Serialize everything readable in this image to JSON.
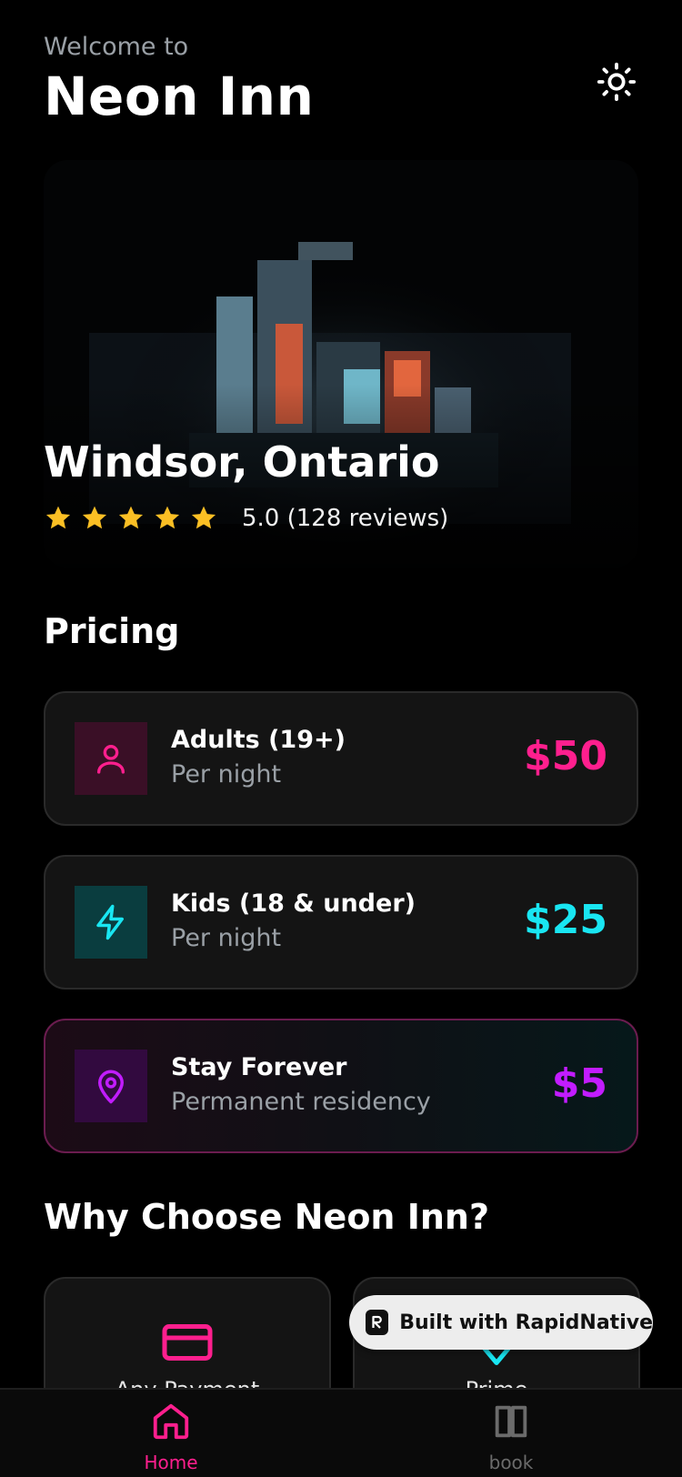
{
  "header": {
    "welcome": "Welcome to",
    "title": "Neon Inn",
    "theme_icon": "sun-icon"
  },
  "hero": {
    "location": "Windsor, Ontario",
    "stars": 5,
    "rating_text": "5.0 (128 reviews)"
  },
  "pricing": {
    "title": "Pricing",
    "items": [
      {
        "name": "Adults (19+)",
        "sub": "Per night",
        "price": "$50",
        "icon": "user-icon",
        "color": "#ff1f8e"
      },
      {
        "name": "Kids (18 & under)",
        "sub": "Per night",
        "price": "$25",
        "icon": "lightning-icon",
        "color": "#19e6f2"
      },
      {
        "name": "Stay Forever",
        "sub": "Permanent residency",
        "price": "$5",
        "icon": "location-pin-icon",
        "color": "#c21cff"
      }
    ]
  },
  "features": {
    "title": "Why Choose Neon Inn?",
    "items": [
      {
        "label": "Any Payment",
        "icon": "credit-card-icon"
      },
      {
        "label": "Prime",
        "icon": "diamond-icon"
      }
    ]
  },
  "badge": {
    "text": "Built with RapidNative"
  },
  "tabs": [
    {
      "label": "Home",
      "icon": "home-icon",
      "active": true
    },
    {
      "label": "book",
      "icon": "book-icon",
      "active": false
    }
  ],
  "colors": {
    "accent_pink": "#ff1f8e",
    "accent_cyan": "#19e6f2",
    "accent_purple": "#c21cff",
    "star": "#fbbf24"
  }
}
